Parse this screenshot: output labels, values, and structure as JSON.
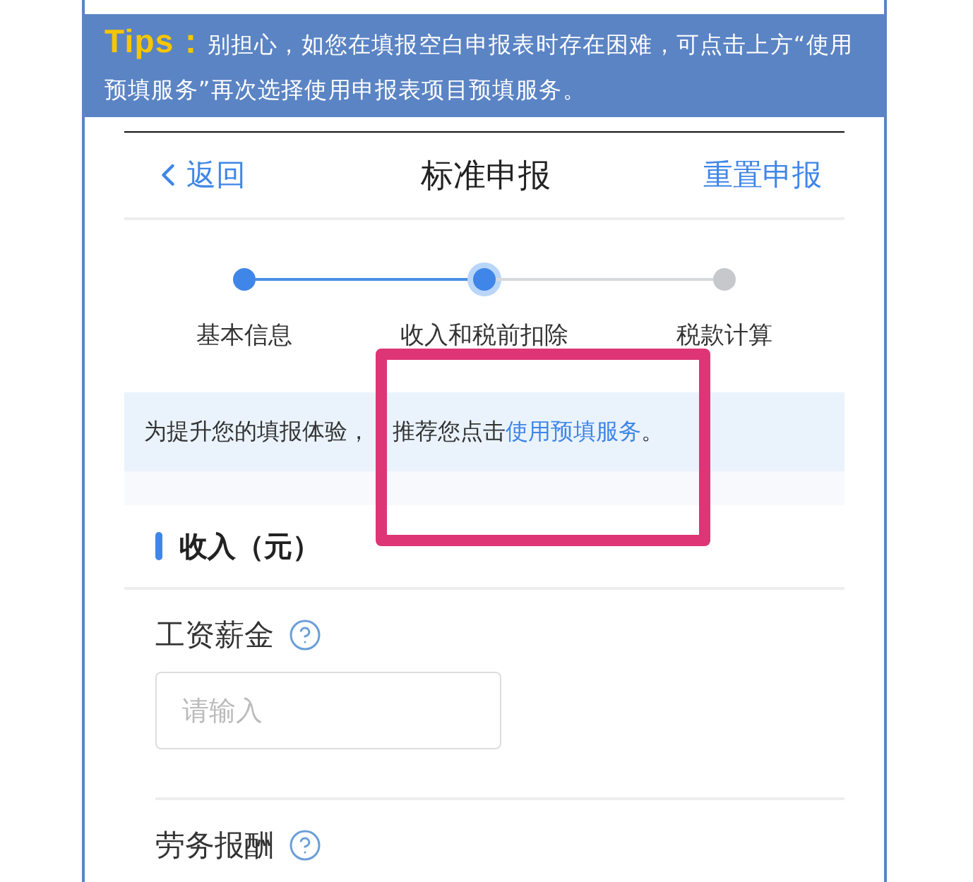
{
  "tips": {
    "text": "**Tips：**别担心，如您在填报空白申报表时存在困难，可点击上方“使用预填服务”再次选择使用申报表项目预填服务。"
  },
  "nav": {
    "back": "返回",
    "title": "标准申报",
    "action": "重置申报"
  },
  "steps": [
    {
      "label": "基本信息",
      "done": true,
      "selected": false
    },
    {
      "label": "收入和税前扣除",
      "done": true,
      "selected": true
    },
    {
      "label": "税款计算",
      "done": false,
      "selected": false
    }
  ],
  "notice": {
    "lead": "为提升您的填报体验，",
    "text": "推荐您点击",
    "link": "使用预填服务",
    "end": "。"
  },
  "section": {
    "title": "收入（元）"
  },
  "fields": [
    {
      "label": "工资薪金",
      "placeholder": "请输入"
    },
    {
      "label": "劳务报酬"
    }
  ]
}
